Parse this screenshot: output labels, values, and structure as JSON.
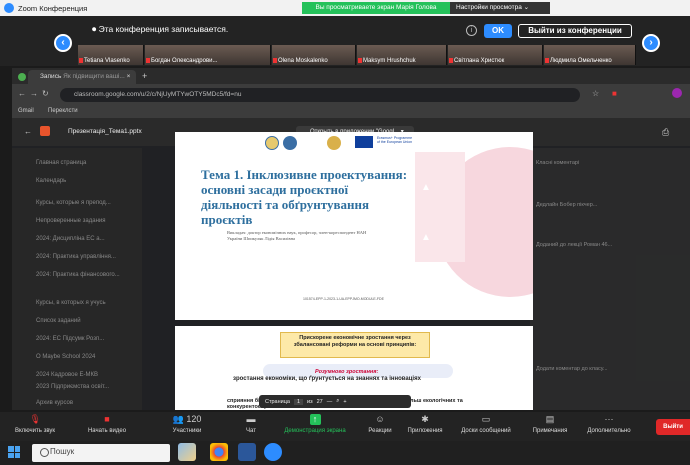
{
  "zoom": {
    "window_title": "Zoom Конференция",
    "sharing_banner": "Вы просматриваете экран Марія Голова",
    "view_settings": "Настройки просмотра",
    "recording_notice": "Эта конференция записывается.",
    "ok_label": "OK",
    "leave_label": "Выйти из конференции",
    "participants": [
      "Tetiana Vlasenko",
      "Богдан Олександрови...",
      "Olena Moskalenko",
      "Maksym Hrushchuk",
      "Світлана Христюк",
      "Людмила Омельченко"
    ]
  },
  "chrome": {
    "tab_title": "Запись",
    "tab_title_2": "Як підвищити ваші...",
    "url": "classroom.google.com/u/2/c/NjUyMTYwOTY5MDc5/fd=nu",
    "bookmarks": [
      "Gmail",
      "Переклсти"
    ]
  },
  "slides_app": {
    "file_name": "Презентація_Тема1.pptx",
    "open_with": "Открыть в приложении \"Googl...",
    "sidebar_items": [
      "Главная страница",
      "Календарь",
      "Курсы, которые я препод...",
      "Непроверенные задания",
      "2024: Дисципліна ЕС а...",
      "2024: Практика управління...",
      "2024: Практика фінансового...",
      "Курсы, в которых я учусь",
      "Список заданий",
      "2024: ЕС Підсумк Розп...",
      "О Maybe School 2024",
      "2024 Кадровое Е-МКВ",
      "2023 Підприємства освіт...",
      "Архив курсов"
    ],
    "right_panel_items": [
      "Класні коментарі",
      "Дедлайн Бобер пікчер...",
      "Доданий до лекції Роман 46...",
      "Додати коментар до класу..."
    ]
  },
  "slide1": {
    "title": "Тема 1. Інклюзивне проектування: основні засади проєктної діяльності та обґрунтування проєктів",
    "subtitle": "Викладач: доктор економічних наук, професор, член-кореспондент НАН України Шпикуляк Лідія Василівна",
    "footer": "101574-EPP-1-2023-1-UA-EPPJMO-MODULE-FDE",
    "erasmus_line1": "Erasmus+ Programme",
    "erasmus_line2": "of the European Union"
  },
  "slide2": {
    "box_text": "Прискорене економічне зростання через збалансовані реформи на основі принципів:",
    "rozumne": "Розумного зростання:",
    "line1": "зростання економіки, що ґрунтується на знаннях та інноваціях",
    "line2": "сприяння більш ефективному використанню ресурсів, розвитку більш екологічних та конкурентоспроможної економіки"
  },
  "pager": {
    "label": "Страница",
    "current": "1",
    "of": "из",
    "total": "27",
    "minus": "—",
    "plus": "+"
  },
  "toolbar": {
    "mute": "Включить звук",
    "video": "Начать видео",
    "participants": "Участники",
    "participants_count": "120",
    "chat": "Чат",
    "share": "Демонстрация экрана",
    "reactions": "Реакции",
    "apps": "Приложения",
    "whiteboards": "Доски сообщений",
    "notes": "Примечания",
    "more": "Дополнительно",
    "exit": "Выйти"
  },
  "taskbar": {
    "search_placeholder": "Пошук"
  },
  "colors": {
    "zoom_blue": "#2d8cff",
    "share_green": "#24c15a",
    "exit_red": "#e02828",
    "slide_title": "#2e6f9e"
  }
}
